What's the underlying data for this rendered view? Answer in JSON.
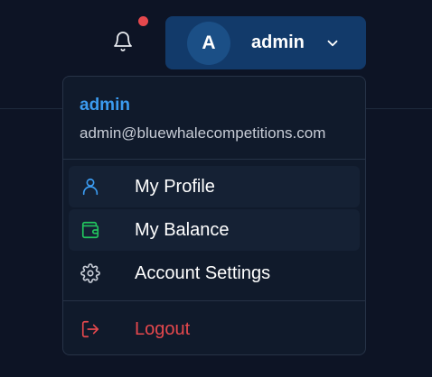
{
  "header": {
    "notification_icon": "bell-icon",
    "has_unread": true,
    "user": {
      "avatar_initial": "A",
      "name": "admin",
      "chevron_icon": "chevron-down-icon"
    }
  },
  "menu": {
    "user_name": "admin",
    "user_email": "admin@bluewhalecompetitions.com",
    "items": [
      {
        "label": "My Profile",
        "icon": "user-icon",
        "color": "#3b9bf0"
      },
      {
        "label": "My Balance",
        "icon": "wallet-icon",
        "color": "#22c55e"
      },
      {
        "label": "Account Settings",
        "icon": "gear-icon",
        "color": "#c7ccd6"
      }
    ],
    "logout": {
      "label": "Logout",
      "icon": "logout-icon",
      "color": "#e5484d"
    }
  },
  "colors": {
    "background": "#0d1425",
    "menu_background": "#101a2b",
    "user_button": "#123a6a",
    "accent": "#3b9bf0",
    "danger": "#e5484d",
    "notification_dot": "#e5484d"
  }
}
